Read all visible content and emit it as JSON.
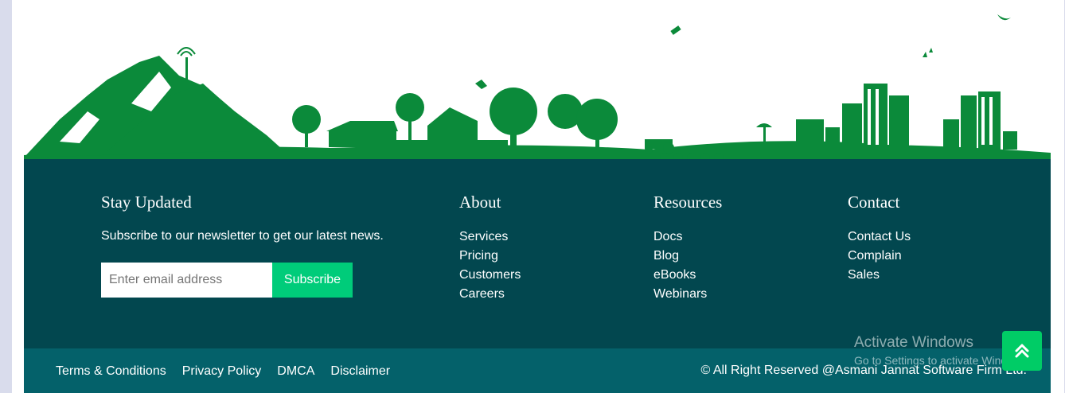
{
  "newsletter": {
    "title": "Stay Updated",
    "text": "Subscribe to our newsletter to get our latest news.",
    "placeholder": "Enter email address",
    "button": "Subscribe"
  },
  "about": {
    "title": "About",
    "links": [
      "Services",
      "Pricing",
      "Customers",
      "Careers"
    ]
  },
  "resources": {
    "title": "Resources",
    "links": [
      "Docs",
      "Blog",
      "eBooks",
      "Webinars"
    ]
  },
  "contact": {
    "title": "Contact",
    "links": [
      "Contact Us",
      "Complain",
      "Sales"
    ]
  },
  "bottom": {
    "links": [
      "Terms & Conditions",
      "Privacy Policy",
      "DMCA",
      "Disclaimer"
    ],
    "copyright": "© All Right Reserved @Asmani Jannat Software Firm Ltd."
  },
  "watermark": {
    "title": "Activate Windows",
    "subtitle": "Go to Settings to activate Windows."
  },
  "colors": {
    "scene_green": "#0b8a3a",
    "footer_bg": "#02474f",
    "bottom_bg": "#04616a",
    "accent": "#00cc7a"
  },
  "icons": {
    "scroll_top": "double-chevron-up-icon"
  }
}
